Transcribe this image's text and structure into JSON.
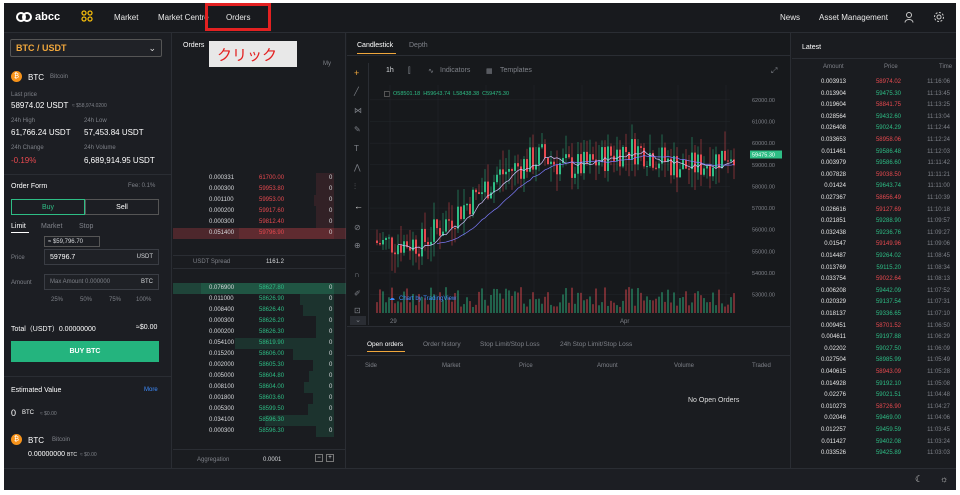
{
  "header": {
    "logo": "abcc",
    "nav": [
      "Market",
      "Market Centre",
      "Orders"
    ],
    "right_nav": [
      "News",
      "Asset Management"
    ]
  },
  "tooltip": {
    "text": "クリック"
  },
  "sidebar": {
    "pair": "BTC / USDT",
    "coin": "BTC",
    "coin_name": "Bitcoin",
    "last_price_label": "Last price",
    "last_price": "58974.02 USDT",
    "last_price_alt": "≈ $58,974.0200",
    "high_label": "24h High",
    "high": "61,766.24 USDT",
    "low_label": "24h Low",
    "low": "57,453.84 USDT",
    "change_label": "24h Change",
    "change": "-0.19%",
    "volume_label": "24h Volume",
    "volume": "6,689,914.95 USDT",
    "order_form": "Order Form",
    "fee": "Fee: 0.1%",
    "buy": "Buy",
    "sell": "Sell",
    "tabs": [
      "Limit",
      "Market",
      "Stop"
    ],
    "approx": "≈ $59,796.70",
    "price_label": "Price",
    "price": "59796.7",
    "price_unit": "USDT",
    "amount_label": "Amount",
    "amount_placeholder": "Max Amount 0.000000",
    "amount_unit": "BTC",
    "pcts": [
      "25%",
      "50%",
      "75%",
      "100%"
    ],
    "total_label": "Total（USDT）0.00000000",
    "total_val": "≈$0.00",
    "buy_btn": "BUY BTC",
    "est_label": "Estimated Value",
    "more": "More",
    "est_value": "0",
    "est_unit": "BTC",
    "est_usd": "≈ $0.00",
    "balance_coin": "BTC",
    "balance_name": "Bitcoin",
    "balance": "0.00000000",
    "balance_unit": "BTC",
    "balance_usd": "≈ $0.00"
  },
  "orders": {
    "title": "Orders",
    "my_label": "My",
    "sell_rows": [
      {
        "a": "0.000331",
        "p": "61700.00",
        "m": "0"
      },
      {
        "a": "0.000300",
        "p": "59953.80",
        "m": "0"
      },
      {
        "a": "0.001100",
        "p": "59953.00",
        "m": "0"
      },
      {
        "a": "0.000200",
        "p": "59917.60",
        "m": "0"
      },
      {
        "a": "0.000300",
        "p": "59812.40",
        "m": "0"
      },
      {
        "a": "0.051400",
        "p": "59796.90",
        "m": "0"
      }
    ],
    "spread_label": "USDT Spread",
    "spread": "1161.2",
    "buy_rows": [
      {
        "a": "0.076900",
        "p": "58627.80",
        "m": "0"
      },
      {
        "a": "0.011000",
        "p": "58626.90",
        "m": "0"
      },
      {
        "a": "0.008400",
        "p": "58626.40",
        "m": "0"
      },
      {
        "a": "0.000300",
        "p": "58626.20",
        "m": "0"
      },
      {
        "a": "0.000200",
        "p": "58626.30",
        "m": "0"
      },
      {
        "a": "0.054100",
        "p": "58619.90",
        "m": "0"
      },
      {
        "a": "0.015200",
        "p": "58606.00",
        "m": "0"
      },
      {
        "a": "0.002000",
        "p": "58605.30",
        "m": "0"
      },
      {
        "a": "0.005000",
        "p": "58604.80",
        "m": "0"
      },
      {
        "a": "0.008100",
        "p": "58604.00",
        "m": "0"
      },
      {
        "a": "0.001800",
        "p": "58603.60",
        "m": "0"
      },
      {
        "a": "0.005300",
        "p": "58599.50",
        "m": "0"
      },
      {
        "a": "0.034100",
        "p": "58596.30",
        "m": "0"
      },
      {
        "a": "0.000300",
        "p": "58596.30",
        "m": "0"
      }
    ],
    "aggregation_label": "Aggregation",
    "aggregation": "0.0001"
  },
  "chart": {
    "tabs": [
      "Candlestick",
      "Depth"
    ],
    "interval": "1h",
    "indicators": "Indicators",
    "templates": "Templates",
    "ohlc": {
      "o": "O58501.18",
      "h": "H59643.74",
      "l": "L58438.38",
      "c": "C59475.30"
    },
    "yticks": [
      "62000.00",
      "61000.00",
      "60000.00",
      "59000.00",
      "58000.00",
      "57000.00",
      "56000.00",
      "55000.00",
      "54000.00",
      "53000.00"
    ],
    "current": "59475.30",
    "xticks": [
      "29",
      "Apr"
    ],
    "watermark": "Chart by TradingView"
  },
  "openorders": {
    "tabs": [
      "Open orders",
      "Order history",
      "Stop Limit/Stop Loss",
      "24h Stop Limit/Stop Loss"
    ],
    "cols": [
      "Side",
      "Market",
      "Price",
      "Amount",
      "Volume",
      "Traded"
    ],
    "empty": "No Open Orders"
  },
  "latest": {
    "title": "Latest",
    "cols": [
      "Amount",
      "Price",
      "Time"
    ],
    "rows": [
      {
        "a": "0.003913",
        "p": "58974.02",
        "t": "11:16:06",
        "c": "red"
      },
      {
        "a": "0.013904",
        "p": "59475.30",
        "t": "11:13:45",
        "c": "green"
      },
      {
        "a": "0.019604",
        "p": "58841.75",
        "t": "11:13:25",
        "c": "red"
      },
      {
        "a": "0.028564",
        "p": "59432.60",
        "t": "11:13:04",
        "c": "green"
      },
      {
        "a": "0.026408",
        "p": "59024.29",
        "t": "11:12:44",
        "c": "green"
      },
      {
        "a": "0.033653",
        "p": "58958.06",
        "t": "11:12:24",
        "c": "red"
      },
      {
        "a": "0.011461",
        "p": "59586.48",
        "t": "11:12:03",
        "c": "green"
      },
      {
        "a": "0.003979",
        "p": "59586.60",
        "t": "11:11:42",
        "c": "green"
      },
      {
        "a": "0.007828",
        "p": "59038.50",
        "t": "11:11:21",
        "c": "red"
      },
      {
        "a": "0.01424",
        "p": "59643.74",
        "t": "11:11:00",
        "c": "green"
      },
      {
        "a": "0.027367",
        "p": "58656.49",
        "t": "11:10:39",
        "c": "red"
      },
      {
        "a": "0.026616",
        "p": "59127.69",
        "t": "11:10:18",
        "c": "red"
      },
      {
        "a": "0.021851",
        "p": "59288.90",
        "t": "11:09:57",
        "c": "green"
      },
      {
        "a": "0.032438",
        "p": "59236.76",
        "t": "11:09:27",
        "c": "green"
      },
      {
        "a": "0.01547",
        "p": "59149.96",
        "t": "11:09:06",
        "c": "red"
      },
      {
        "a": "0.014487",
        "p": "59264.02",
        "t": "11:08:45",
        "c": "green"
      },
      {
        "a": "0.013769",
        "p": "59115.20",
        "t": "11:08:34",
        "c": "green"
      },
      {
        "a": "0.033754",
        "p": "59022.64",
        "t": "11:08:13",
        "c": "red"
      },
      {
        "a": "0.006208",
        "p": "59442.09",
        "t": "11:07:52",
        "c": "green"
      },
      {
        "a": "0.020329",
        "p": "59137.54",
        "t": "11:07:31",
        "c": "green"
      },
      {
        "a": "0.018137",
        "p": "59336.65",
        "t": "11:07:10",
        "c": "green"
      },
      {
        "a": "0.009451",
        "p": "58701.52",
        "t": "11:06:50",
        "c": "red"
      },
      {
        "a": "0.004611",
        "p": "59197.88",
        "t": "11:06:29",
        "c": "green"
      },
      {
        "a": "0.02202",
        "p": "59027.50",
        "t": "11:06:09",
        "c": "green"
      },
      {
        "a": "0.027504",
        "p": "58985.99",
        "t": "11:05:49",
        "c": "green"
      },
      {
        "a": "0.040615",
        "p": "58943.09",
        "t": "11:05:28",
        "c": "red"
      },
      {
        "a": "0.014928",
        "p": "59192.10",
        "t": "11:05:08",
        "c": "green"
      },
      {
        "a": "0.02276",
        "p": "59021.51",
        "t": "11:04:48",
        "c": "green"
      },
      {
        "a": "0.010273",
        "p": "58726.90",
        "t": "11:04:27",
        "c": "red"
      },
      {
        "a": "0.02046",
        "p": "59469.00",
        "t": "11:04:06",
        "c": "green"
      },
      {
        "a": "0.012257",
        "p": "59459.59",
        "t": "11:03:45",
        "c": "green"
      },
      {
        "a": "0.011427",
        "p": "59402.08",
        "t": "11:03:24",
        "c": "green"
      },
      {
        "a": "0.033526",
        "p": "59425.89",
        "t": "11:03:03",
        "c": "green"
      }
    ]
  },
  "colors": {
    "accent": "#f0b90b",
    "green": "#2ebd85",
    "red": "#e6494f",
    "highlight": "#e32121"
  }
}
